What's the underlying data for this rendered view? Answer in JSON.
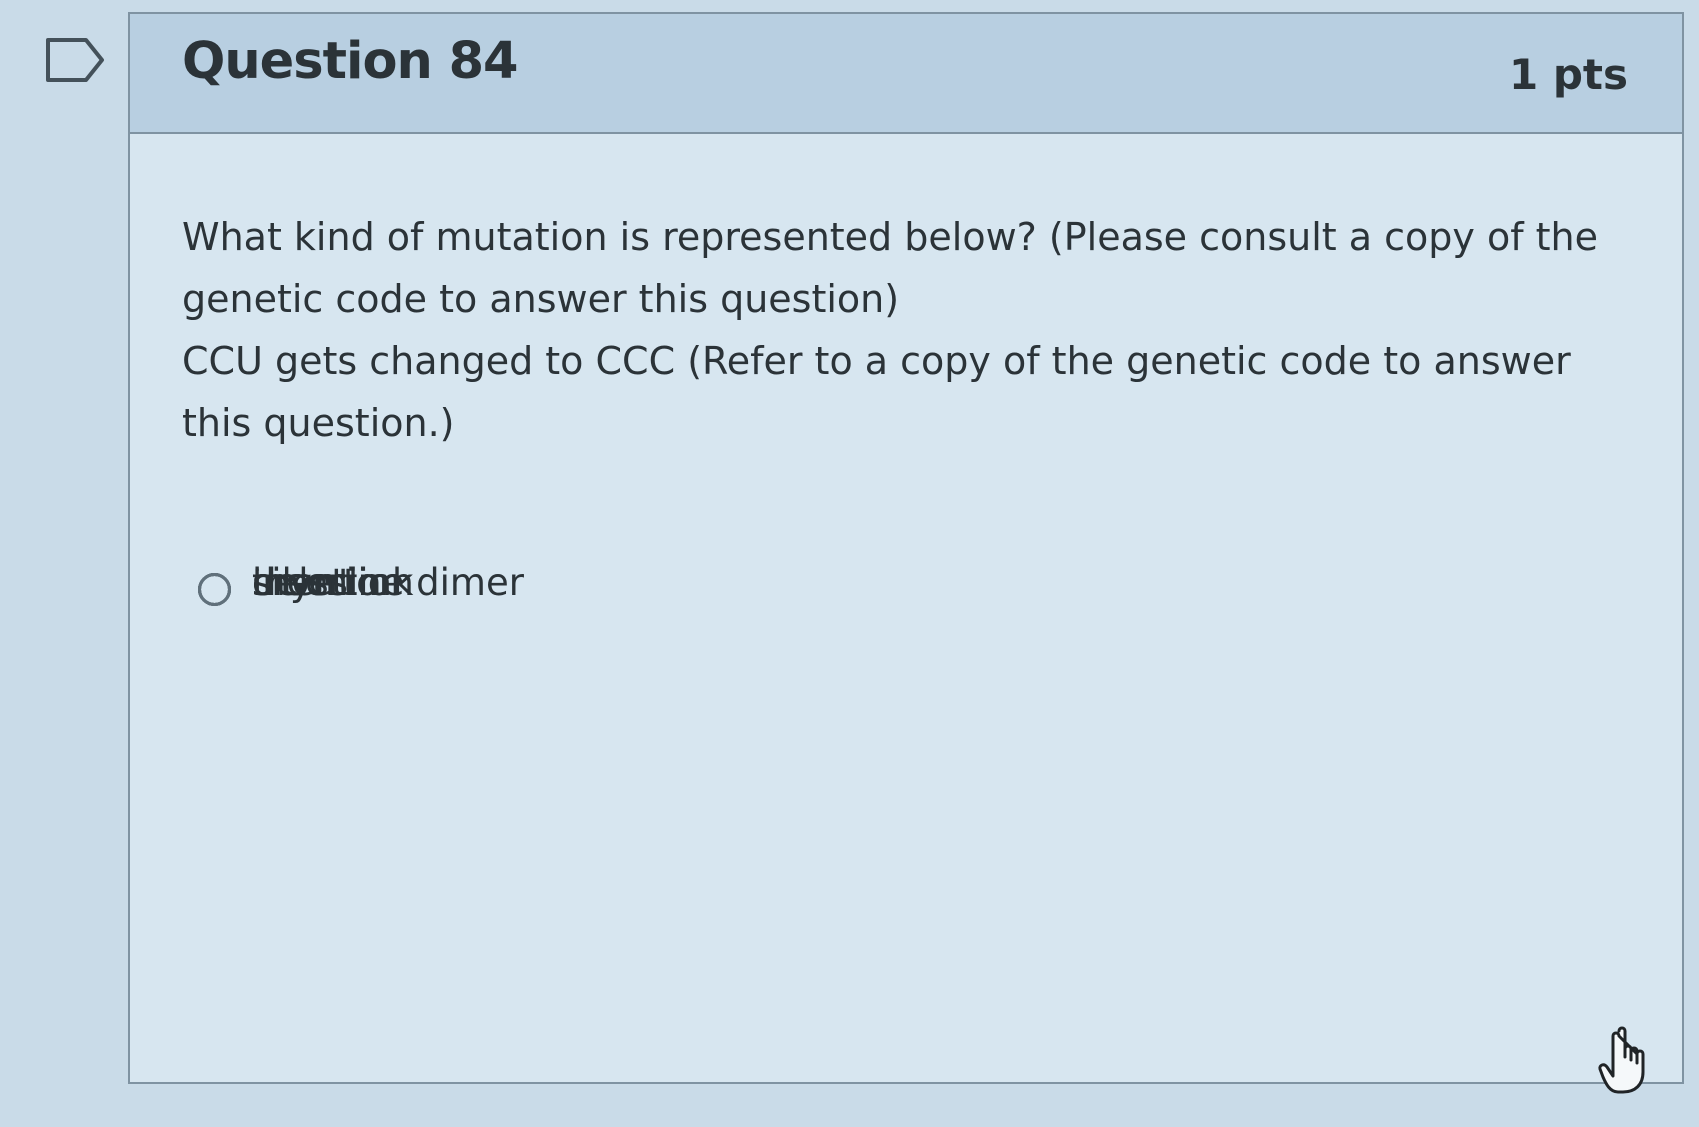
{
  "question": {
    "title": "Question 84",
    "points": "1 pts",
    "prompt_lines": [
      "What kind of mutation is represented below?  (Please consult a copy of the",
      "genetic code to answer this question)",
      "CCU  gets changed to  CCC     (Refer to a copy of the genetic code to answer",
      "this question.)"
    ]
  },
  "answers": [
    {
      "label": "crosslink",
      "selected": false
    },
    {
      "label": "insertion",
      "selected": false
    },
    {
      "label": "silent",
      "selected": false
    },
    {
      "label": "thymine dimer",
      "selected": false
    },
    {
      "label": "deletion",
      "selected": false
    }
  ],
  "icons": {
    "flag": "flag-outline-icon",
    "cursor": "hand-pointer-icon"
  },
  "colors": {
    "background": "#c9dbe8",
    "header": "#b8cfe1",
    "card": "#d7e6f0",
    "border": "#7f93a2",
    "text": "#2b3338"
  }
}
